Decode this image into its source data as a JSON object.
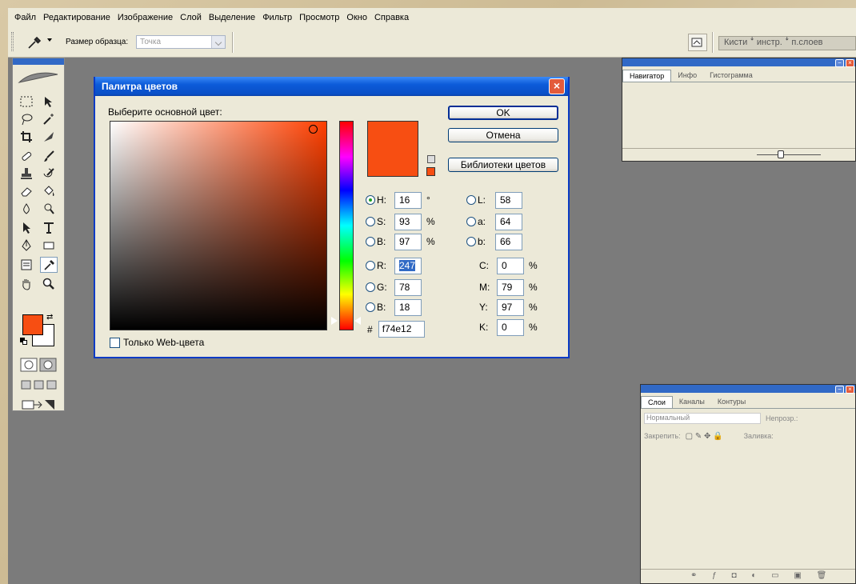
{
  "menu": {
    "items": [
      "Файл",
      "Редактирование",
      "Изображение",
      "Слой",
      "Выделение",
      "Фильтр",
      "Просмотр",
      "Окно",
      "Справка"
    ]
  },
  "options_bar": {
    "tool_icon": "eyedropper-icon",
    "sample_size_label": "Размер образца:",
    "sample_size_value": "Точка",
    "well_tabs_label": "Кисти ꜜ инстр. ꜜ п.слоев"
  },
  "toolbox": {
    "tools": [
      "marquee",
      "move",
      "lasso",
      "magic-wand",
      "crop",
      "slice",
      "healing",
      "brush",
      "stamp",
      "history-brush",
      "eraser",
      "bucket",
      "blur",
      "dodge",
      "path-select",
      "type",
      "pen",
      "shape",
      "notes",
      "eyedropper",
      "hand",
      "zoom"
    ],
    "foreground_color": "#f74e12",
    "background_color": "#ffffff"
  },
  "color_picker": {
    "title": "Палитра цветов",
    "prompt": "Выберите основной цвет:",
    "buttons": {
      "ok": "OK",
      "cancel": "Отмена",
      "libraries": "Библиотеки цветов"
    },
    "current_color": "#f74e12",
    "hsb": [
      {
        "label": "H:",
        "value": "16",
        "unit": "°",
        "selected": true
      },
      {
        "label": "S:",
        "value": "93",
        "unit": "%"
      },
      {
        "label": "B:",
        "value": "97",
        "unit": "%"
      }
    ],
    "rgb": [
      {
        "label": "R:",
        "value": "247"
      },
      {
        "label": "G:",
        "value": "78"
      },
      {
        "label": "B:",
        "value": "18"
      }
    ],
    "lab": [
      {
        "label": "L:",
        "value": "58"
      },
      {
        "label": "a:",
        "value": "64"
      },
      {
        "label": "b:",
        "value": "66"
      }
    ],
    "cmyk": [
      {
        "label": "C:",
        "value": "0",
        "unit": "%"
      },
      {
        "label": "M:",
        "value": "79",
        "unit": "%"
      },
      {
        "label": "Y:",
        "value": "97",
        "unit": "%"
      },
      {
        "label": "K:",
        "value": "0",
        "unit": "%"
      }
    ],
    "hex_label": "#",
    "hex_value": "f74e12",
    "web_only_label": "Только Web-цвета"
  },
  "navigator_panel": {
    "tabs": [
      "Навигатор",
      "Инфо",
      "Гистограмма"
    ]
  },
  "layers_panel": {
    "tabs": [
      "Слои",
      "Каналы",
      "Контуры"
    ],
    "blend_mode": "Нормальный",
    "opacity_label": "Непрозр.:",
    "lock_label": "Закрепить:",
    "fill_label": "Заливка:"
  }
}
